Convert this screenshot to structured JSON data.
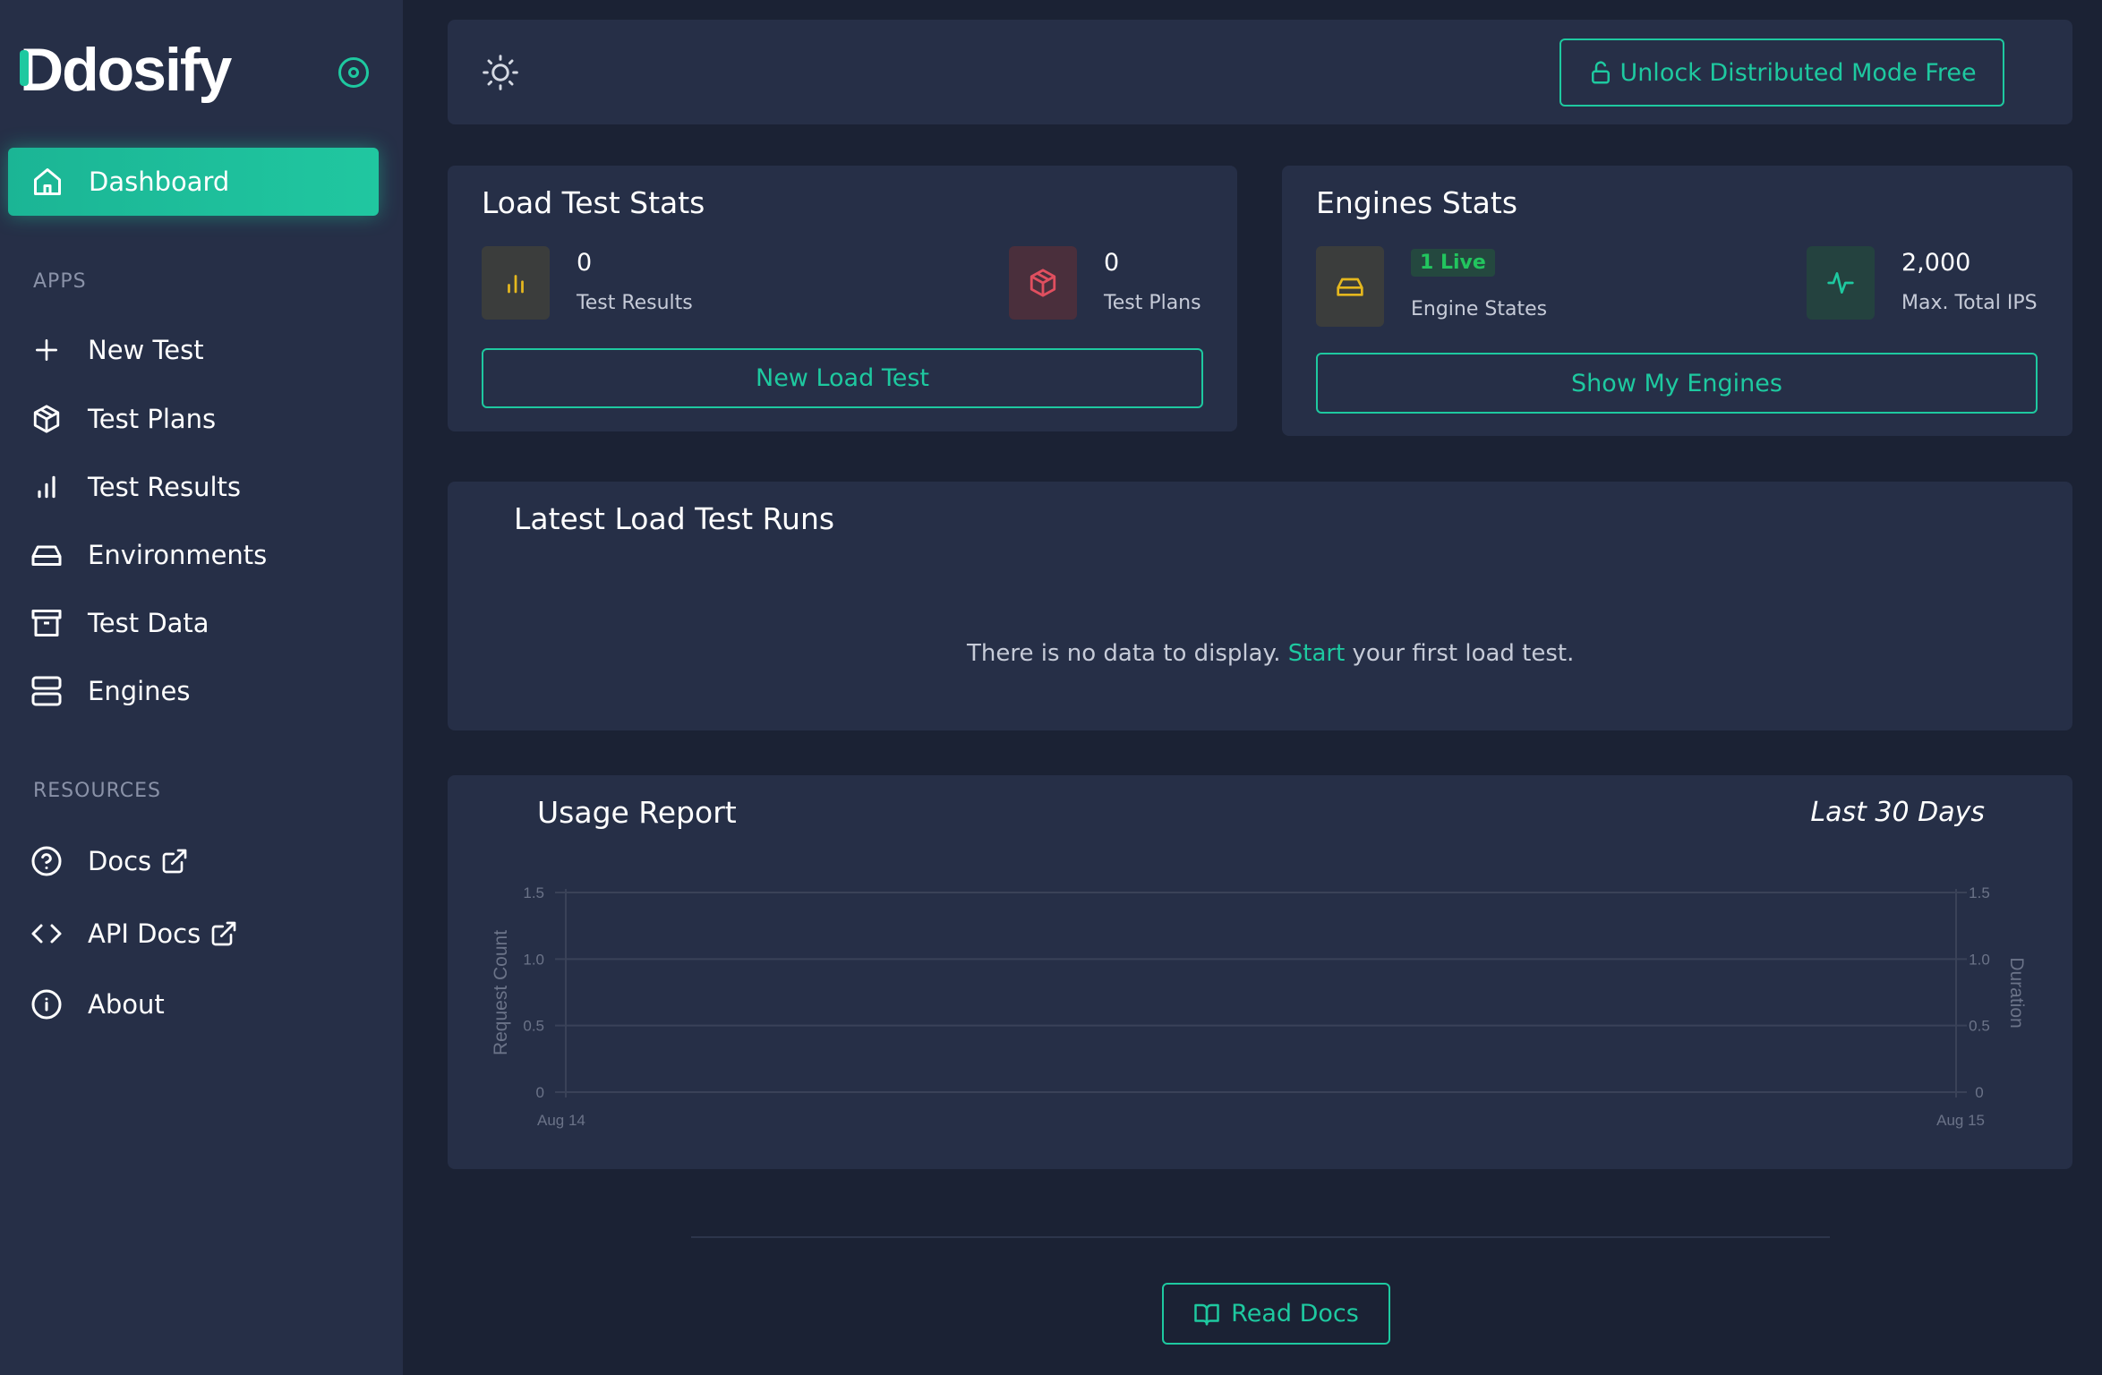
{
  "app": {
    "logo_text": "Ddosify"
  },
  "sidebar": {
    "active_item": {
      "label": "Dashboard",
      "icon": "home-icon"
    },
    "apps_section_label": "APPS",
    "apps_items": [
      {
        "label": "New Test",
        "icon": "plus-icon"
      },
      {
        "label": "Test Plans",
        "icon": "cube-icon"
      },
      {
        "label": "Test Results",
        "icon": "bar-chart-icon"
      },
      {
        "label": "Environments",
        "icon": "drive-icon"
      },
      {
        "label": "Test Data",
        "icon": "archive-icon"
      },
      {
        "label": "Engines",
        "icon": "server-icon"
      }
    ],
    "resources_section_label": "RESOURCES",
    "resources_items": [
      {
        "label": "Docs",
        "icon": "help-circle-icon",
        "external": true
      },
      {
        "label": "API Docs",
        "icon": "code-icon",
        "external": true
      },
      {
        "label": "About",
        "icon": "info-icon",
        "external": false
      }
    ]
  },
  "topbar": {
    "theme_icon": "sun-icon",
    "unlock_button_label": "Unlock Distributed Mode Free"
  },
  "load_test_stats": {
    "title": "Load Test Stats",
    "test_results_value": "0",
    "test_results_label": "Test Results",
    "test_plans_value": "0",
    "test_plans_label": "Test Plans",
    "button_label": "New Load Test"
  },
  "engines_stats": {
    "title": "Engines Stats",
    "live_badge": "1 Live",
    "engine_states_label": "Engine States",
    "max_ips_value": "2,000",
    "max_ips_label": "Max. Total IPS",
    "button_label": "Show My Engines"
  },
  "latest_runs": {
    "title": "Latest Load Test Runs",
    "empty_prefix": "There is no data to display. ",
    "empty_link": "Start",
    "empty_suffix": " your first load test."
  },
  "usage_report": {
    "title": "Usage Report",
    "range_label": "Last 30 Days"
  },
  "chart_data": {
    "type": "line",
    "title": "Usage Report",
    "x": [
      "Aug 14",
      "Aug 15"
    ],
    "series": [],
    "ylabel": "Request Count",
    "y2label": "Duration",
    "ylim": [
      0,
      1.5
    ],
    "y2lim": [
      0,
      1.5
    ],
    "yticks": [
      "0",
      "0.5",
      "1.0",
      "1.5"
    ],
    "grid": true
  },
  "footer": {
    "read_docs_label": "Read Docs"
  },
  "colors": {
    "accent": "#1ec9a0",
    "background": "#1b2234",
    "panel": "#262f47"
  }
}
